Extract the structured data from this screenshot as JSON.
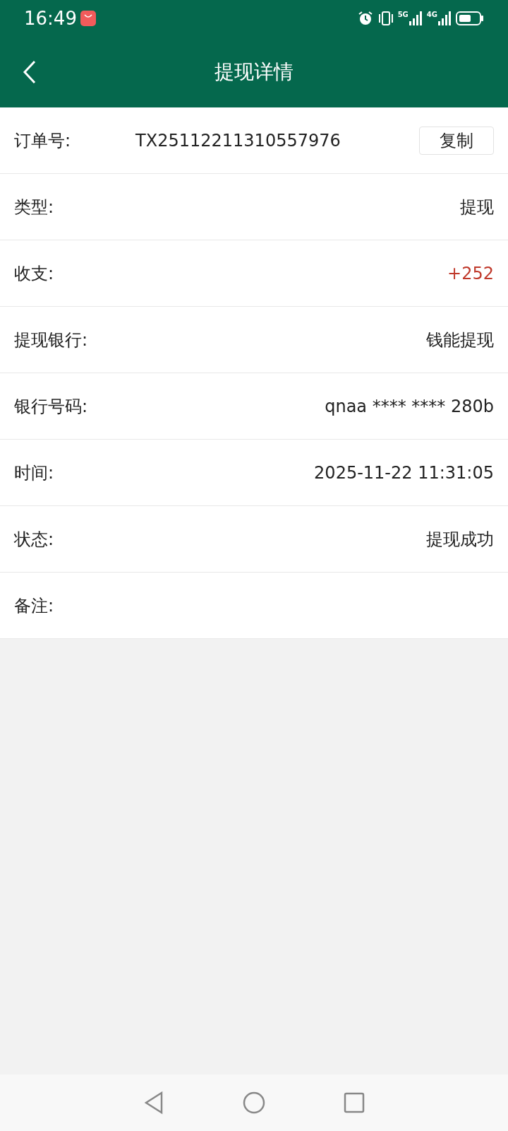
{
  "status_bar": {
    "time": "16:49",
    "network_labels": [
      "5G",
      "4G"
    ]
  },
  "header": {
    "title": "提现详情"
  },
  "rows": [
    {
      "kind": "copyable",
      "label": "订单号:",
      "value": "TX25112211310557976",
      "button": "复制"
    },
    {
      "kind": "text",
      "label": "类型:",
      "value": "提现"
    },
    {
      "kind": "amount",
      "label": "收支:",
      "value": "+252"
    },
    {
      "kind": "text",
      "label": "提现银行:",
      "value": "钱能提现"
    },
    {
      "kind": "text",
      "label": "银行号码:",
      "value": "qnaa **** **** 280b"
    },
    {
      "kind": "text",
      "label": "时间:",
      "value": "2025-11-22 11:31:05"
    },
    {
      "kind": "text",
      "label": "状态:",
      "value": "提现成功"
    },
    {
      "kind": "text",
      "label": "备注:"
    }
  ]
}
